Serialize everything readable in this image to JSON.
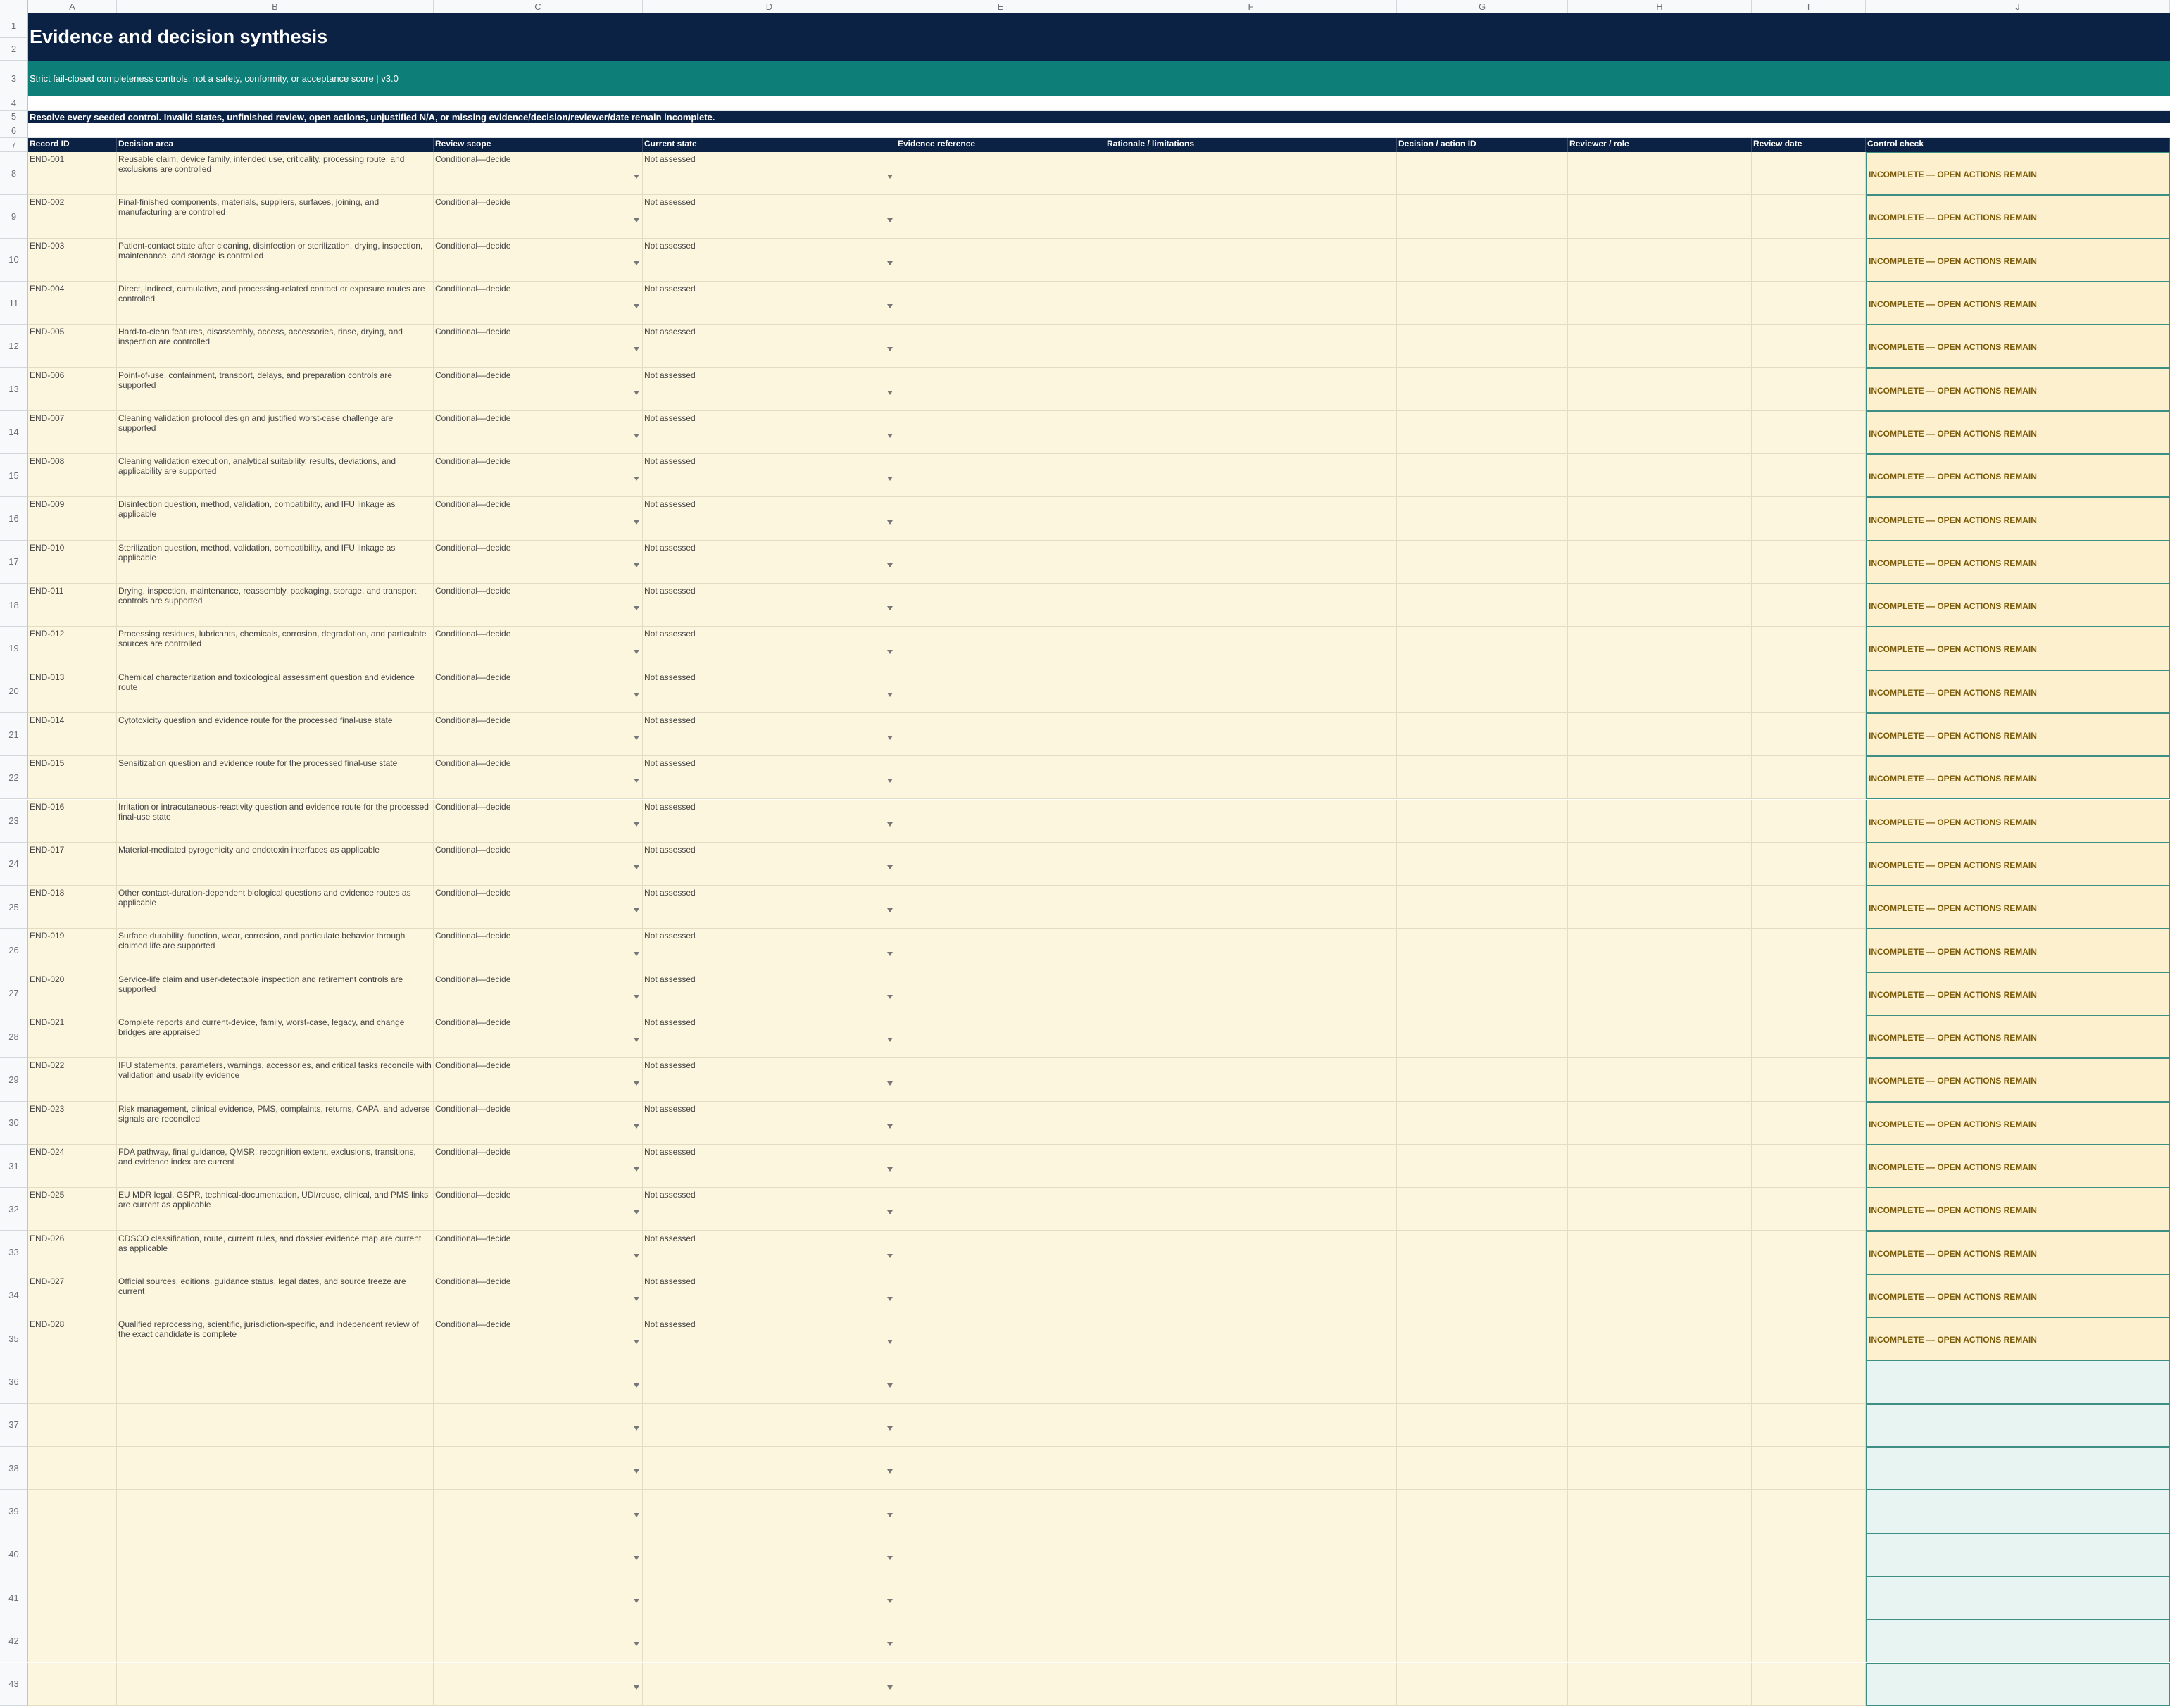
{
  "sheet": {
    "columns": [
      "A",
      "B",
      "C",
      "D",
      "E",
      "F",
      "G",
      "H",
      "I",
      "J"
    ],
    "title": "Evidence and decision synthesis",
    "subtitle": "Strict fail-closed completeness controls; not a safety, conformity, or acceptance score | v3.0",
    "instruction": "Resolve every seeded control. Invalid states, unfinished review, open actions, unjustified N/A, or missing evidence/decision/reviewer/date remain incomplete.",
    "headers": [
      "Record ID",
      "Decision area",
      "Review scope",
      "Current state",
      "Evidence reference",
      "Rationale / limitations",
      "Decision / action ID",
      "Reviewer / role",
      "Review date",
      "Control check"
    ],
    "default_scope": "Conditional—decide",
    "default_state": "Not assessed",
    "check_text": "INCOMPLETE — OPEN ACTIONS REMAIN",
    "records": [
      {
        "id": "END-001",
        "area": "Reusable claim, device family, intended use, criticality, processing route, and exclusions are controlled"
      },
      {
        "id": "END-002",
        "area": "Final-finished components, materials, suppliers, surfaces, joining, and manufacturing are controlled"
      },
      {
        "id": "END-003",
        "area": "Patient-contact state after cleaning, disinfection or sterilization, drying, inspection, maintenance, and storage is controlled"
      },
      {
        "id": "END-004",
        "area": "Direct, indirect, cumulative, and processing-related contact or exposure routes are controlled"
      },
      {
        "id": "END-005",
        "area": "Hard-to-clean features, disassembly, access, accessories, rinse, drying, and inspection are controlled"
      },
      {
        "id": "END-006",
        "area": "Point-of-use, containment, transport, delays, and preparation controls are supported"
      },
      {
        "id": "END-007",
        "area": "Cleaning validation protocol design and justified worst-case challenge are supported"
      },
      {
        "id": "END-008",
        "area": "Cleaning validation execution, analytical suitability, results, deviations, and applicability are supported"
      },
      {
        "id": "END-009",
        "area": "Disinfection question, method, validation, compatibility, and IFU linkage as applicable"
      },
      {
        "id": "END-010",
        "area": "Sterilization question, method, validation, compatibility, and IFU linkage as applicable"
      },
      {
        "id": "END-011",
        "area": "Drying, inspection, maintenance, reassembly, packaging, storage, and transport controls are supported"
      },
      {
        "id": "END-012",
        "area": "Processing residues, lubricants, chemicals, corrosion, degradation, and particulate sources are controlled"
      },
      {
        "id": "END-013",
        "area": "Chemical characterization and toxicological assessment question and evidence route"
      },
      {
        "id": "END-014",
        "area": "Cytotoxicity question and evidence route for the processed final-use state"
      },
      {
        "id": "END-015",
        "area": "Sensitization question and evidence route for the processed final-use state"
      },
      {
        "id": "END-016",
        "area": "Irritation or intracutaneous-reactivity question and evidence route for the processed final-use state"
      },
      {
        "id": "END-017",
        "area": "Material-mediated pyrogenicity and endotoxin interfaces as applicable"
      },
      {
        "id": "END-018",
        "area": "Other contact-duration-dependent biological questions and evidence routes as applicable"
      },
      {
        "id": "END-019",
        "area": "Surface durability, function, wear, corrosion, and particulate behavior through claimed life are supported"
      },
      {
        "id": "END-020",
        "area": "Service-life claim and user-detectable inspection and retirement controls are supported"
      },
      {
        "id": "END-021",
        "area": "Complete reports and current-device, family, worst-case, legacy, and change bridges are appraised"
      },
      {
        "id": "END-022",
        "area": "IFU statements, parameters, warnings, accessories, and critical tasks reconcile with validation and usability evidence"
      },
      {
        "id": "END-023",
        "area": "Risk management, clinical evidence, PMS, complaints, returns, CAPA, and adverse signals are reconciled"
      },
      {
        "id": "END-024",
        "area": "FDA pathway, final guidance, QMSR, recognition extent, exclusions, transitions, and evidence index are current"
      },
      {
        "id": "END-025",
        "area": "EU MDR legal, GSPR, technical-documentation, UDI/reuse, clinical, and PMS links are current as applicable"
      },
      {
        "id": "END-026",
        "area": "CDSCO classification, route, current rules, and dossier evidence map are current as applicable"
      },
      {
        "id": "END-027",
        "area": "Official sources, editions, guidance status, legal dates, and source freeze are current"
      },
      {
        "id": "END-028",
        "area": "Qualified reprocessing, scientific, jurisdiction-specific, and independent review of the exact candidate is complete"
      }
    ],
    "row_numbers": [
      "1",
      "2",
      "3",
      "4",
      "5",
      "6",
      "7",
      "8",
      "9",
      "10",
      "11",
      "12",
      "13",
      "14",
      "15",
      "16",
      "17",
      "18",
      "19",
      "20",
      "21",
      "22",
      "23",
      "24",
      "25",
      "26",
      "27",
      "28",
      "29",
      "30",
      "31",
      "32",
      "33",
      "34",
      "35",
      "36",
      "37",
      "38",
      "39",
      "40",
      "41",
      "42",
      "43"
    ]
  }
}
